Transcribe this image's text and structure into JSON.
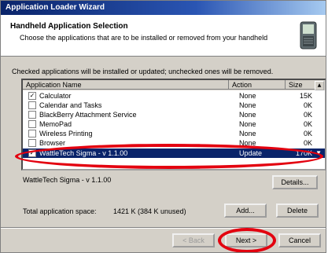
{
  "window": {
    "title": "Application Loader Wizard"
  },
  "header": {
    "title": "Handheld Application Selection",
    "subtitle": "Choose the applications that are to be installed or removed from your handheld"
  },
  "caption": "Checked applications will be installed or updated; unchecked ones will be removed.",
  "columns": {
    "name": "Application Name",
    "action": "Action",
    "size": "Size"
  },
  "rows": [
    {
      "checked": true,
      "name": "Calculator",
      "action": "None",
      "size": "15K"
    },
    {
      "checked": false,
      "name": "Calendar and Tasks",
      "action": "None",
      "size": "0K"
    },
    {
      "checked": false,
      "name": "BlackBerry Attachment Service",
      "action": "None",
      "size": "0K"
    },
    {
      "checked": false,
      "name": "MemoPad",
      "action": "None",
      "size": "0K"
    },
    {
      "checked": false,
      "name": "Wireless Printing",
      "action": "None",
      "size": "0K"
    },
    {
      "checked": false,
      "name": "Browser",
      "action": "None",
      "size": "0K"
    },
    {
      "checked": true,
      "name": "WattleTech Sigma - v 1.1.00",
      "action": "Update",
      "size": "170K",
      "selected": true
    }
  ],
  "selected_description": "WattleTech Sigma - v 1.1.00",
  "buttons": {
    "details": "Details...",
    "add": "Add...",
    "delete": "Delete",
    "back": "< Back",
    "next": "Next >",
    "cancel": "Cancel"
  },
  "space": {
    "label": "Total application space:",
    "value": "1421 K  (384 K unused)"
  },
  "colors": {
    "highlight": "#e3000f",
    "selection": "#0a246a",
    "face": "#d4d0c8"
  },
  "icons": {
    "check": "check-mark",
    "scroll_up": "scroll-up-arrow",
    "scroll_down": "scroll-down-arrow",
    "device": "handheld-device-icon"
  }
}
